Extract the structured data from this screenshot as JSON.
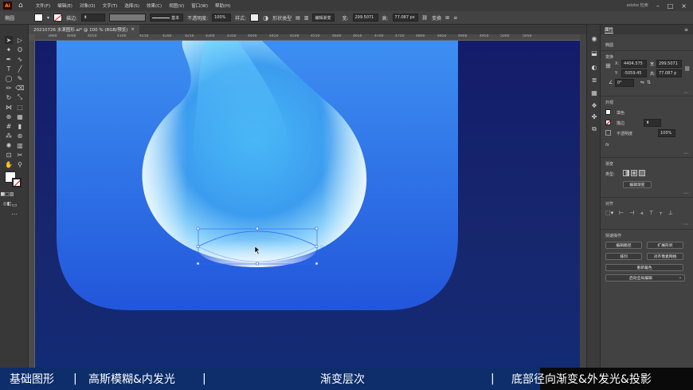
{
  "menubar": {
    "logo": "Ai",
    "menus": [
      "文件(F)",
      "编辑(E)",
      "对象(O)",
      "文字(T)",
      "选择(S)",
      "效果(C)",
      "视图(V)",
      "窗口(W)",
      "帮助(H)"
    ],
    "right_label": "adobe 检索"
  },
  "control": {
    "selection_label": "椭圆",
    "stroke_label": "描边:",
    "stroke_style": "基本",
    "opacity_label": "不透明度:",
    "opacity_value": "100%",
    "style_label": "样式:",
    "shape_label": "形状类型",
    "edit_label": "编辑渐变",
    "w_label": "宽:",
    "w_value": "299.5071",
    "h_label": "高:",
    "h_value": "77.087 px",
    "transform_label": "变换"
  },
  "doc_tab": {
    "title": "20210726 水滴图形.ai* @ 100 % (RGB/预览)",
    "close": "×"
  },
  "ruler_ticks": [
    "3900",
    "4000",
    "4050",
    "4100",
    "4150",
    "4200",
    "4250",
    "4300",
    "4350",
    "4400",
    "4450",
    "4500",
    "4550",
    "4600",
    "4650",
    "4700",
    "4750",
    "4800",
    "4850",
    "4900",
    "4950",
    "5000",
    "5050"
  ],
  "panel": {
    "tab": "属性",
    "section_shape": "椭圆",
    "transform_title": "变换",
    "x_label": "X:",
    "x_value": "4404.575",
    "y_label": "Y:",
    "y_value": "-5059.45",
    "w_label": "宽:",
    "w_value": "299.5071",
    "h_label": "高:",
    "h_value": "77.087 p",
    "angle_value": "0°",
    "appearance_title": "外观",
    "fill_label": "填色",
    "stroke_label": "描边",
    "opacity_label": "不透明度",
    "opacity_value": "100%",
    "fx_label": "fx",
    "gradient_title": "渐变",
    "gradient_type_label": "类型:",
    "edit_gradient_btn": "编辑渐变",
    "align_title": "对齐",
    "quick_title": "快速操作",
    "btn_edit_path": "编辑路径",
    "btn_expand": "扩展形状",
    "btn_arrange": "排列",
    "btn_align_grid": "对齐像素网格",
    "btn_recolor": "重新着色",
    "btn_global": "启动全局编辑"
  },
  "subtitles": {
    "s1": "基础图形",
    "sep1": "|",
    "s2": "高斯模糊&内发光",
    "sep2": "|",
    "s3": "渐变层次",
    "sep3": "|",
    "s4": "底部径向渐变&外发光&投影"
  },
  "colors": {
    "canvas_dark": "#131c6a",
    "card_top": "#2f6fe6",
    "card_bottom": "#1d4fd0",
    "drop_center": "#6fd9f8",
    "selection": "#2f63ff"
  }
}
